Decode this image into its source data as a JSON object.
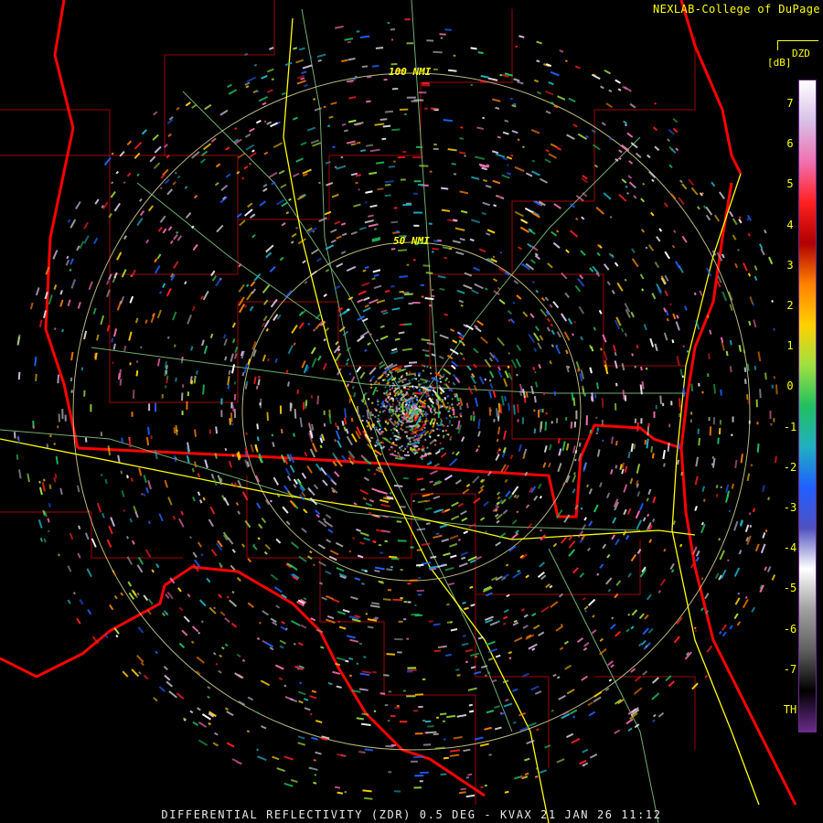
{
  "credit": "NEXLAB-College of DuPage",
  "product_code": "DZD",
  "units": "[dB]",
  "ring_labels": [
    "100 NMI",
    "50 NMI"
  ],
  "scale_labels": [
    "7",
    "6",
    "5",
    "4",
    "3",
    "2",
    "1",
    "0",
    "-1",
    "-2",
    "-3",
    "-4",
    "-5",
    "-6",
    "-7",
    "TH"
  ],
  "footer": "DIFFERENTIAL REFLECTIVITY (ZDR) 0.5 DEG - KVAX 21 JAN 26 11:12",
  "colors": {
    "background": "#000000",
    "state_border": "#ff0000",
    "county_border": "#b00000",
    "highway": "#ffff00",
    "road": "#8fd88f",
    "range_ring": "#d8d890",
    "text": "#ffff00"
  },
  "scale_gradient": [
    "#ffffff",
    "#d8c0e8",
    "#f070b0",
    "#ff2020",
    "#b00000",
    "#ff8000",
    "#ffd000",
    "#a0e040",
    "#20c060",
    "#20b0c0",
    "#2060ff",
    "#5050c0",
    "#ffffff",
    "#a0a0a0",
    "#606060",
    "#000000",
    "#6a2b8a"
  ]
}
